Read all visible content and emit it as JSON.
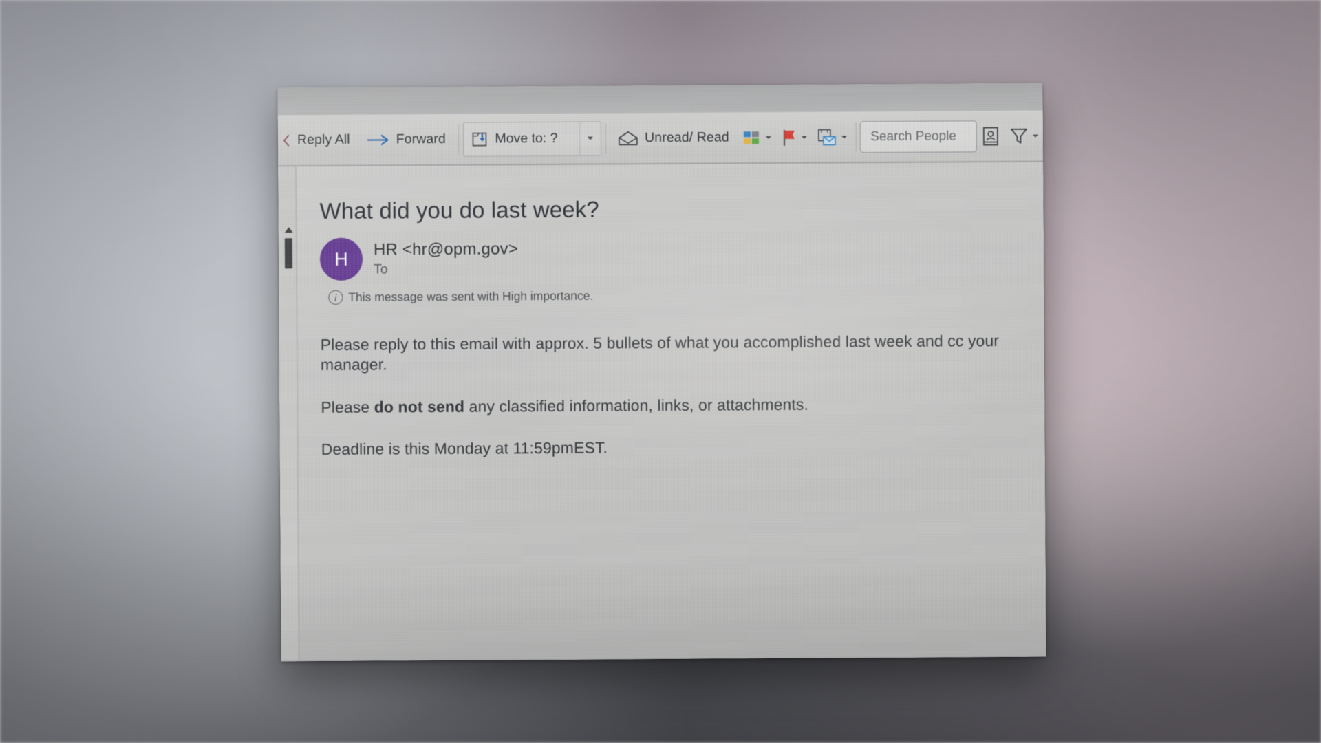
{
  "app": {
    "name": "Microsoft Outlook",
    "view": "reading-pane"
  },
  "toolbar": {
    "reply_all_label": "Reply All",
    "forward_label": "Forward",
    "move_to_label": "Move to: ?",
    "unread_read_label": "Unread/ Read",
    "categorize_icon": "categorize-icon",
    "flag_icon": "flag-icon",
    "follow_up_icon": "follow-up-icon",
    "address_book_icon": "address-book-icon",
    "filter_icon": "filter-funnel-icon",
    "search_people_placeholder": "Search People",
    "search_people_value": ""
  },
  "message": {
    "subject": "What did you do last week?",
    "sender": "HR <hr@opm.gov>",
    "avatar_initial": "H",
    "avatar_color": "#5b2d8e",
    "to_label": "To",
    "to_value": "",
    "importance_notice": "This message was sent with High importance.",
    "body": [
      {
        "id": "p1",
        "segments": [
          {
            "text": "Please reply to this email with approx. 5 bullets of what you accomplished last week and cc your manager.",
            "bold": false
          }
        ]
      },
      {
        "id": "p2",
        "segments": [
          {
            "text": "Please ",
            "bold": false
          },
          {
            "text": "do not send",
            "bold": true
          },
          {
            "text": " any classified information, links, or attachments.",
            "bold": false
          }
        ]
      },
      {
        "id": "p3",
        "segments": [
          {
            "text": "Deadline is this Monday at 11:59pmEST.",
            "bold": false
          }
        ]
      }
    ]
  },
  "scrollbar": {
    "up_arrow": "scroll-up-arrow",
    "thumb": "scroll-thumb"
  },
  "colors": {
    "accent_purple": "#5b2d8e",
    "flag_red": "#d9342b",
    "link_blue": "#1f5faa",
    "screen_bg": "#c7c7c6",
    "toolbar_bg": "#cdcdcc"
  }
}
